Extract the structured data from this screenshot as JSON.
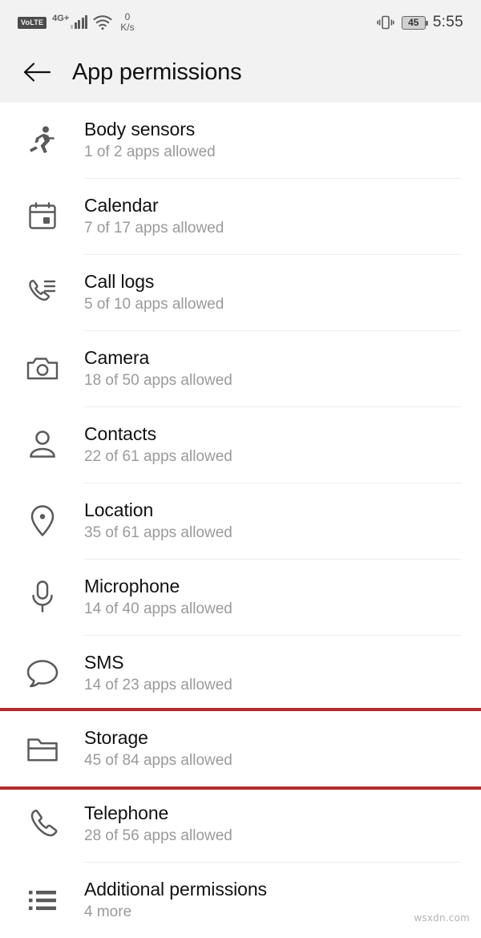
{
  "status_bar": {
    "volte_label": "VoLTE",
    "network_type": "4G+",
    "signal_icon": "signal-bars-icon",
    "wifi_icon": "wifi-icon",
    "data_speed_value": "0",
    "data_speed_unit": "K/s",
    "vibrate_icon": "vibrate-icon",
    "battery_percent": "45",
    "time": "5:55"
  },
  "app_bar": {
    "back_icon": "back-arrow-icon",
    "title": "App permissions"
  },
  "permissions": [
    {
      "icon": "body-sensors-icon",
      "title": "Body sensors",
      "subtitle": "1 of 2 apps allowed",
      "highlighted": false
    },
    {
      "icon": "calendar-icon",
      "title": "Calendar",
      "subtitle": "7 of 17 apps allowed",
      "highlighted": false
    },
    {
      "icon": "call-logs-icon",
      "title": "Call logs",
      "subtitle": "5 of 10 apps allowed",
      "highlighted": false
    },
    {
      "icon": "camera-icon",
      "title": "Camera",
      "subtitle": "18 of 50 apps allowed",
      "highlighted": false
    },
    {
      "icon": "contacts-icon",
      "title": "Contacts",
      "subtitle": "22 of 61 apps allowed",
      "highlighted": false
    },
    {
      "icon": "location-icon",
      "title": "Location",
      "subtitle": "35 of 61 apps allowed",
      "highlighted": false
    },
    {
      "icon": "microphone-icon",
      "title": "Microphone",
      "subtitle": "14 of 40 apps allowed",
      "highlighted": false
    },
    {
      "icon": "sms-icon",
      "title": "SMS",
      "subtitle": "14 of 23 apps allowed",
      "highlighted": false
    },
    {
      "icon": "storage-folder-icon",
      "title": "Storage",
      "subtitle": "45 of 84 apps allowed",
      "highlighted": true
    },
    {
      "icon": "telephone-icon",
      "title": "Telephone",
      "subtitle": "28 of 56 apps allowed",
      "highlighted": false
    },
    {
      "icon": "additional-permissions-icon",
      "title": "Additional permissions",
      "subtitle": "4 more",
      "highlighted": false
    }
  ],
  "watermark": "wsxdn.com",
  "colors": {
    "highlight": "#b32c2c",
    "header_bg": "#f2f2f2",
    "icon": "#5a5a5a",
    "subtitle": "#9a9a9a"
  }
}
